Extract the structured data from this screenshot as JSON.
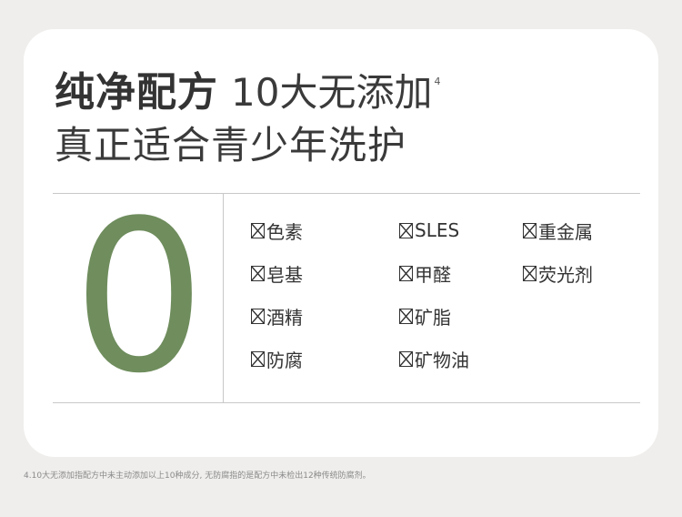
{
  "title": {
    "bold": "纯净配方",
    "light": "10大无添加",
    "superscript": "4",
    "subtitle": "真正适合青少年洗护"
  },
  "big_number": "0",
  "accent_color": "#6f8d5d",
  "items": [
    {
      "label": "色素",
      "icon": "checkbox-x-icon"
    },
    {
      "label": "SLES",
      "icon": "checkbox-x-icon"
    },
    {
      "label": "重金属",
      "icon": "checkbox-x-icon"
    },
    {
      "label": "皂基",
      "icon": "checkbox-x-icon"
    },
    {
      "label": "甲醛",
      "icon": "checkbox-x-icon"
    },
    {
      "label": "荧光剂",
      "icon": "checkbox-x-icon"
    },
    {
      "label": "酒精",
      "icon": "checkbox-x-icon"
    },
    {
      "label": "矿脂",
      "icon": "checkbox-x-icon"
    },
    {
      "label": "防腐",
      "icon": "checkbox-x-icon"
    },
    {
      "label": "矿物油",
      "icon": "checkbox-x-icon"
    }
  ],
  "footnote": "4.10大无添加指配方中未主动添加以上10种成分, 无防腐指的是配方中未检出12种传统防腐剂。"
}
